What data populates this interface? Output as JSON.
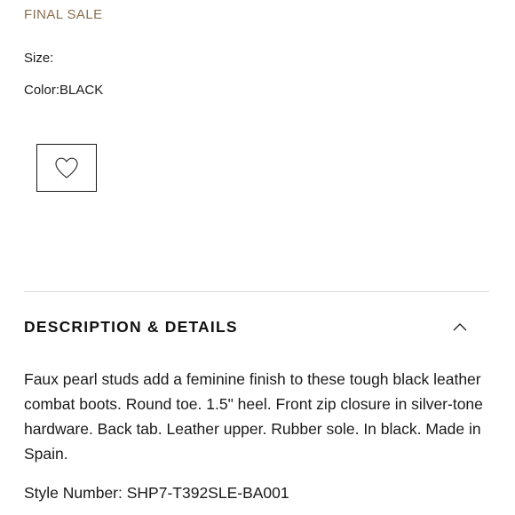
{
  "product": {
    "sale_badge": "FINAL SALE",
    "size_label": "Size:",
    "color_label": "Color:",
    "color_value": "BLACK"
  },
  "wishlist": {
    "icon": "heart-outline-icon"
  },
  "details": {
    "title": "DESCRIPTION & DETAILS",
    "expanded": true,
    "description": "Faux pearl studs add a feminine finish to these tough black leather combat boots. Round toe. 1.5\" heel. Front zip closure in silver-tone hardware. Back tab. Leather upper. Rubber sole. In black. Made in Spain.",
    "style_number_label": "Style Number:",
    "style_number_value": "SHP7-T392SLE-BA001"
  },
  "colors": {
    "sale_text": "#8a6e4e",
    "text": "#1a1a1a",
    "divider": "#dcdcdc"
  }
}
